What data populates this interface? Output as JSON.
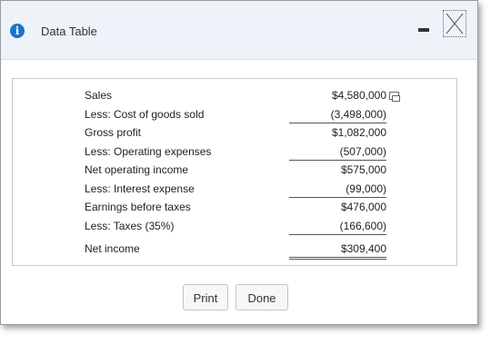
{
  "dialog": {
    "title": "Data Table",
    "icons": {
      "info": "info-icon",
      "minimize": "minimize-icon",
      "close": "close-icon",
      "copy": "copy-icon"
    },
    "accent_color": "#1a73c9"
  },
  "table": {
    "rows": [
      {
        "label": "Sales",
        "value": "$4,580,000"
      },
      {
        "label": "Less: Cost of goods sold",
        "value": "(3,498,000)"
      },
      {
        "label": "Gross profit",
        "value": "$1,082,000"
      },
      {
        "label": "Less: Operating expenses",
        "value": "(507,000)"
      },
      {
        "label": "Net operating income",
        "value": "$575,000"
      },
      {
        "label": "Less: Interest expense",
        "value": "(99,000)"
      },
      {
        "label": "Earnings before taxes",
        "value": "$476,000"
      },
      {
        "label": "Less: Taxes (35%)",
        "value": "(166,600)"
      },
      {
        "label": "Net income",
        "value": "$309,400"
      }
    ]
  },
  "buttons": {
    "print": "Print",
    "done": "Done"
  }
}
